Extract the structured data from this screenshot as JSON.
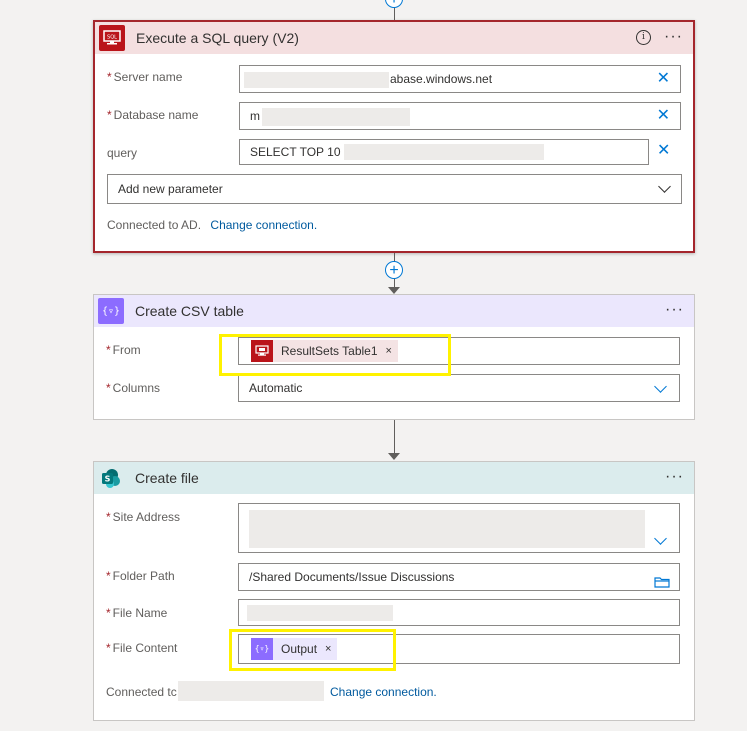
{
  "connectors": {
    "top_plus": "+",
    "mid_plus": "+"
  },
  "sql_card": {
    "title": "Execute a SQL query (V2)",
    "app_icon": "sql-server-icon",
    "info_glyph": "i",
    "more_label": "···",
    "fields": {
      "server_name": {
        "label": "Server name",
        "required": true,
        "value_suffix": "abase.windows.net"
      },
      "database_name": {
        "label": "Database name",
        "required": true,
        "value": "m"
      },
      "query": {
        "label": "query",
        "required": false,
        "value": "SELECT TOP 10 *"
      }
    },
    "add_param": "Add new parameter",
    "connected_text": "Connected to AD.",
    "change_connection": "Change connection.",
    "accent": "#a4262c",
    "header_bg": "#f4dfe0"
  },
  "csv_card": {
    "title": "Create CSV table",
    "app_icon": "data-operation-icon",
    "more_label": "···",
    "from_label": "From",
    "from_token": "ResultSets Table1",
    "columns_label": "Columns",
    "columns_value": "Automatic",
    "header_bg": "#ebe7fd",
    "accent": "#8c6cff"
  },
  "file_card": {
    "title": "Create file",
    "app_icon": "sharepoint-icon",
    "more_label": "···",
    "site_address_label": "Site Address",
    "folder_path_label": "Folder Path",
    "folder_path_value": "/Shared Documents/Issue Discussions",
    "file_name_label": "File Name",
    "file_content_label": "File Content",
    "file_content_token": "Output",
    "connected_text": "Connected tc",
    "change_connection": "Change connection.",
    "header_bg": "#dbeced",
    "accent": "#036c70"
  },
  "token_close": "×",
  "clear_glyph": "✕",
  "required_mark": "*",
  "highlight_color": "#fff200"
}
